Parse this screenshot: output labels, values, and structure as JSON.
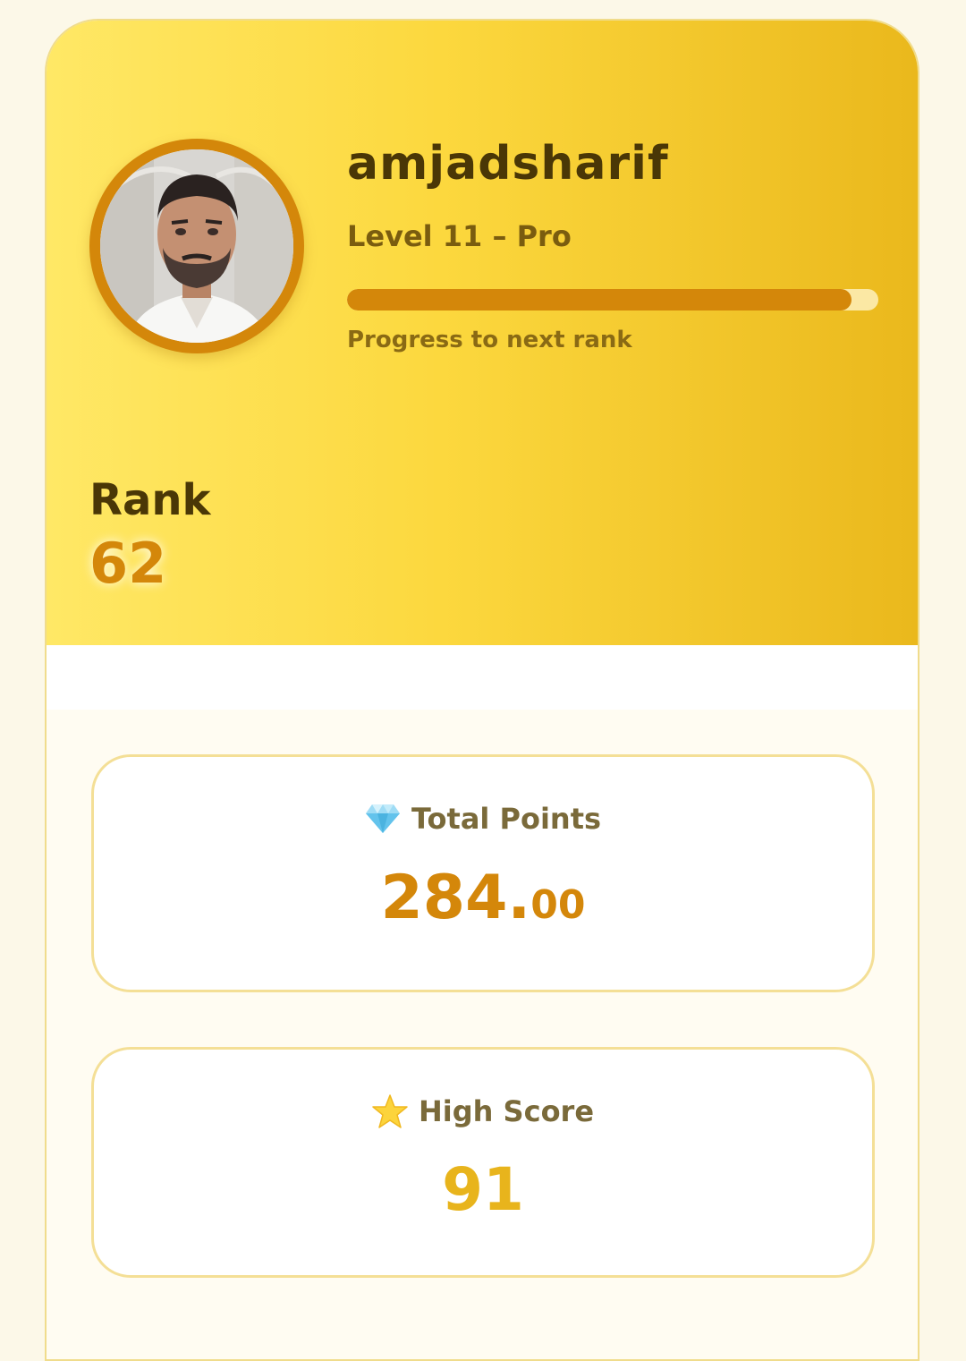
{
  "profile": {
    "username": "amjadsharif",
    "level_text": "Level 11 – Pro",
    "progress_caption": "Progress to next rank",
    "progress_fraction": 0.95,
    "avatar_icon": "user-photo"
  },
  "rank": {
    "label": "Rank",
    "value": "62"
  },
  "stats": {
    "total_points": {
      "icon": "diamond-icon",
      "label": "Total Points",
      "value_main": "284.",
      "value_decimals": "00"
    },
    "high_score": {
      "icon": "star-icon",
      "label": "High Score",
      "value": "91"
    }
  },
  "colors": {
    "accent": "#d4870a",
    "header_start": "#ffe866",
    "header_end": "#eab81c",
    "high_score": "#e8b41c"
  }
}
